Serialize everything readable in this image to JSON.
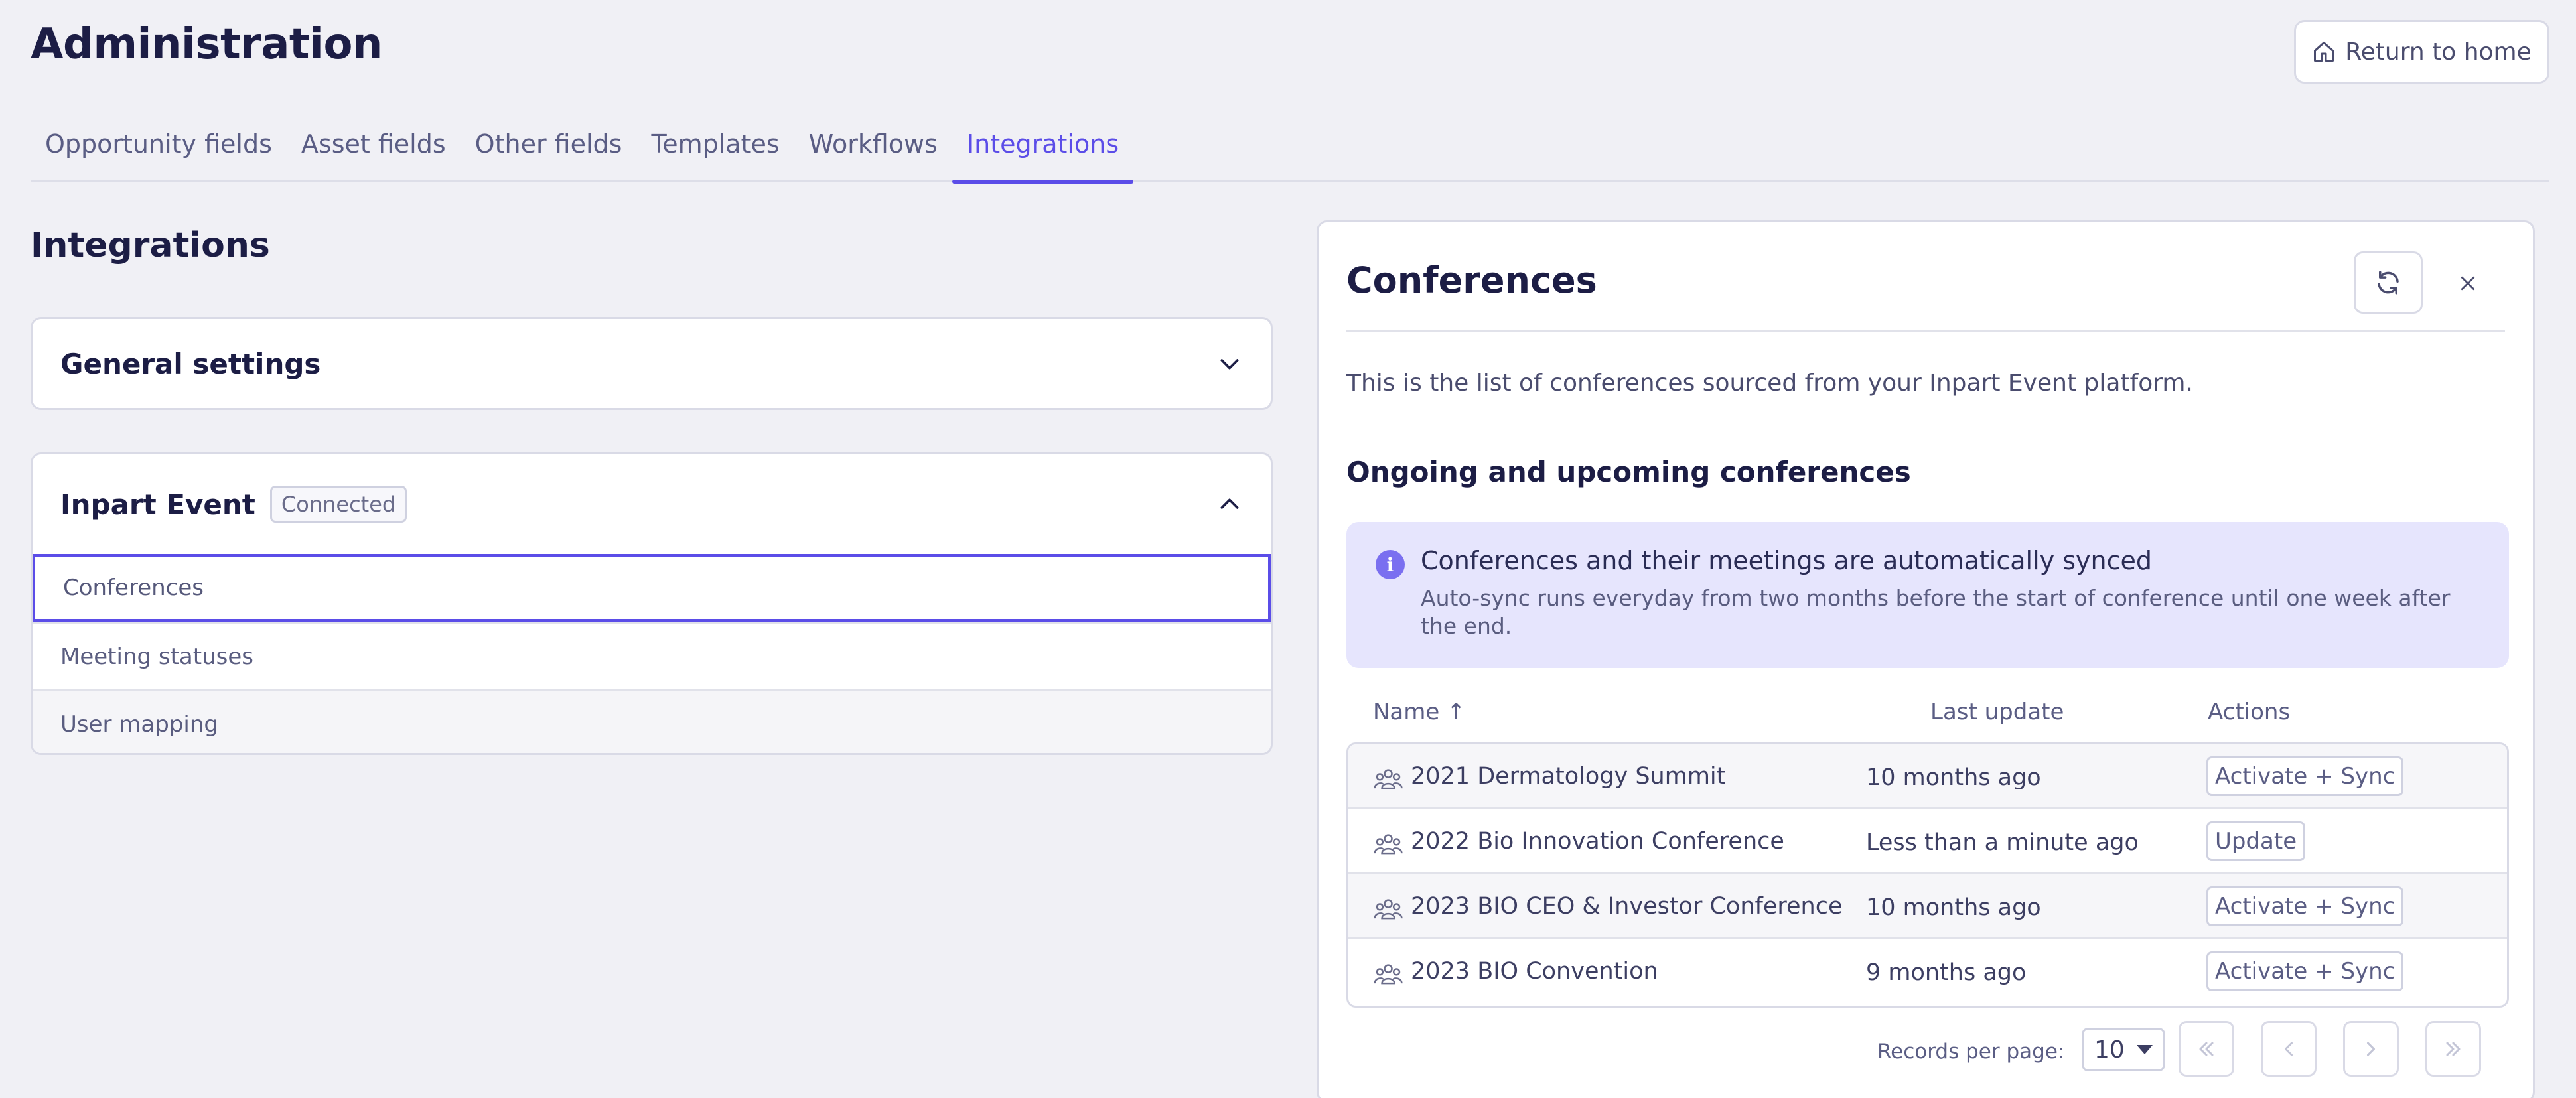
{
  "page": {
    "title": "Administration",
    "return_label": "Return to home"
  },
  "tabs": [
    {
      "label": "Opportunity fields"
    },
    {
      "label": "Asset fields"
    },
    {
      "label": "Other fields"
    },
    {
      "label": "Templates"
    },
    {
      "label": "Workflows"
    },
    {
      "label": "Integrations",
      "active": true
    }
  ],
  "left": {
    "title": "Integrations",
    "general": {
      "title": "General settings"
    },
    "inpart": {
      "title": "Inpart Event",
      "badge": "Connected",
      "items": [
        {
          "label": "Conferences",
          "selected": true
        },
        {
          "label": "Meeting statuses"
        },
        {
          "label": "User mapping"
        }
      ]
    }
  },
  "panel": {
    "title": "Conferences",
    "description": "This is the list of conferences sourced from your Inpart Event platform.",
    "subtitle": "Ongoing and upcoming conferences",
    "info": {
      "title": "Conferences and their meetings are automatically synced",
      "text": "Auto-sync runs everyday from two months before the start of conference until one week after the end."
    },
    "columns": {
      "name": "Name ↑",
      "last_update": "Last update",
      "actions": "Actions"
    },
    "rows": [
      {
        "name": "2021 Dermatology Summit",
        "last_update": "10 months ago",
        "action": "Activate + Sync"
      },
      {
        "name": "2022 Bio Innovation Conference",
        "last_update": "Less than a minute ago",
        "action": "Update"
      },
      {
        "name": "2023 BIO CEO & Investor Conference",
        "last_update": "10 months ago",
        "action": "Activate + Sync"
      },
      {
        "name": "2023 BIO Convention",
        "last_update": "9 months ago",
        "action": "Activate + Sync"
      }
    ],
    "pager": {
      "label": "Records per page:",
      "per_page": "10"
    }
  },
  "icons": {
    "home": "home-icon",
    "chevron_down": "chevron-down-icon",
    "chevron_up": "chevron-up-icon",
    "refresh": "refresh-icon",
    "close": "close-icon",
    "info": "info-icon",
    "conference": "people-group-icon"
  },
  "colors": {
    "accent": "#5b4de8",
    "info_bg": "#e6e5fd",
    "text_dark": "#1c1d45"
  }
}
